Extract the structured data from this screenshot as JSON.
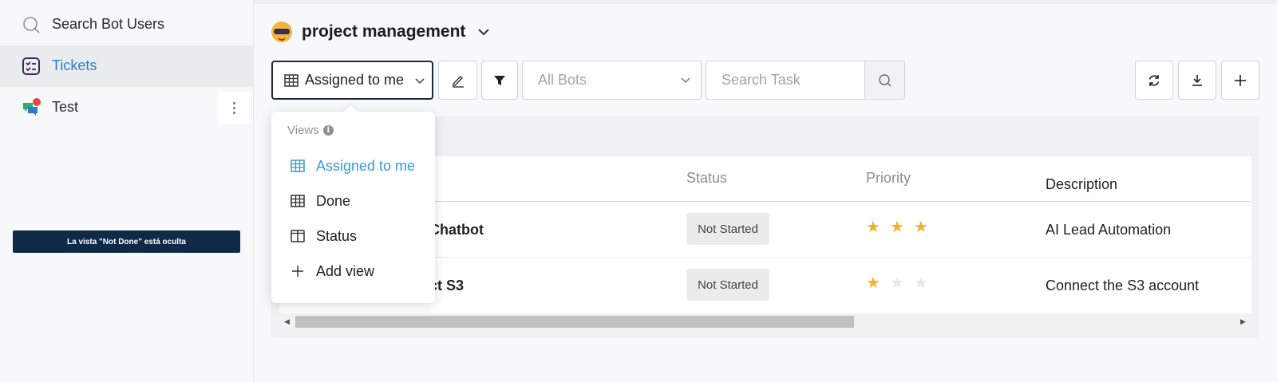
{
  "sidebar": {
    "search_label": "Search Bot Users",
    "items": [
      {
        "label": "Tickets",
        "icon": "checklist-icon",
        "active": true
      },
      {
        "label": "Test",
        "icon": "chat-bubbles-icon",
        "active": false
      }
    ]
  },
  "tooltip": "La vista \"Not Done\" está oculta",
  "header": {
    "title": "project management"
  },
  "toolbar": {
    "view_selected": "Assigned to me",
    "bots_selected": "All Bots",
    "search_placeholder": "Search Task"
  },
  "views_menu": {
    "header": "Views",
    "items": [
      {
        "label": "Assigned to me",
        "icon": "table-icon",
        "active": true
      },
      {
        "label": "Done",
        "icon": "table-icon",
        "active": false
      },
      {
        "label": "Status",
        "icon": "kanban-icon",
        "active": false
      },
      {
        "label": "Add view",
        "icon": "plus-icon",
        "active": false
      }
    ]
  },
  "table": {
    "columns": [
      "Status",
      "Priority",
      "Description"
    ],
    "rows": [
      {
        "task": "Chatbot",
        "status": "Not Started",
        "priority": 3,
        "description": "AI Lead Automation"
      },
      {
        "task": "ct S3",
        "status": "Not Started",
        "priority": 1,
        "description": "Connect the S3 account"
      }
    ]
  },
  "colors": {
    "accent": "#2b7bd1",
    "star": "#f0b429",
    "tooltip_bg": "#0e2a47"
  }
}
